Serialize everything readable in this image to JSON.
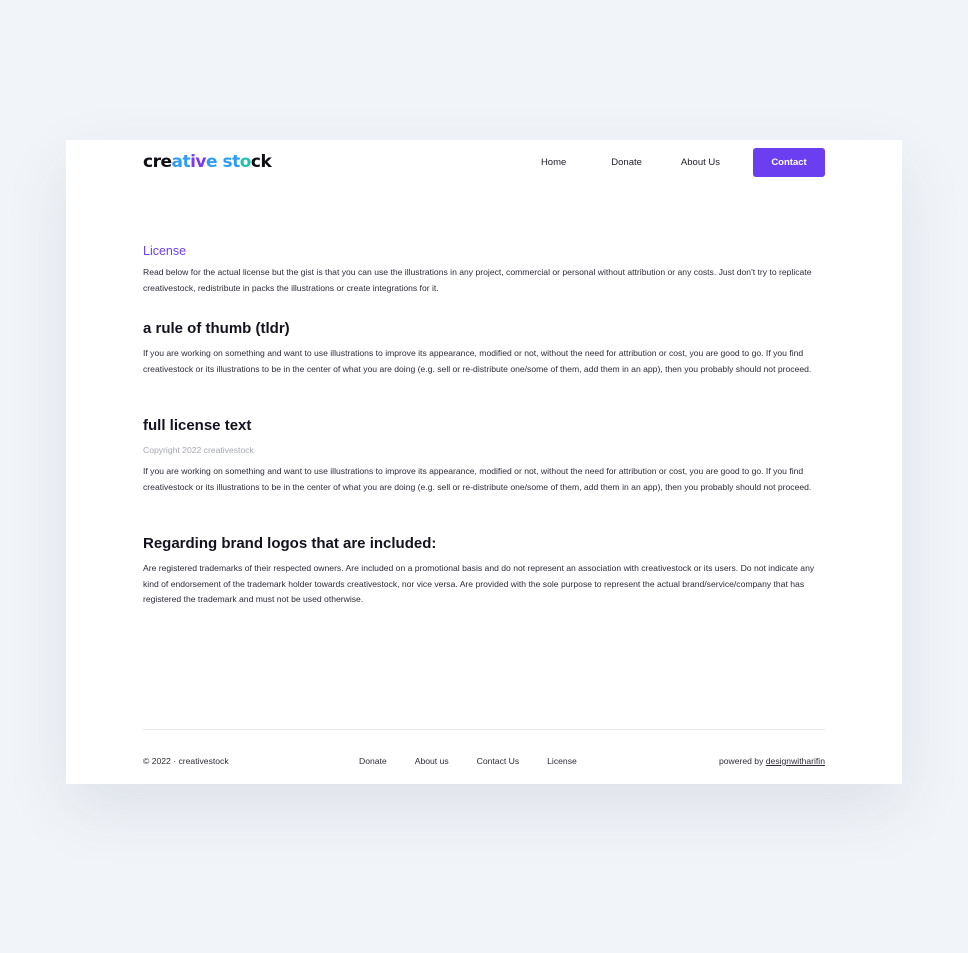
{
  "brand": {
    "logo_parts": [
      "cre",
      "at",
      "iv",
      "e st",
      "o",
      "ck"
    ],
    "logo_text": "creative stock"
  },
  "nav": {
    "home": "Home",
    "donate": "Donate",
    "about": "About Us",
    "contact": "Contact"
  },
  "content": {
    "kicker": "License",
    "intro": "Read below for the actual license but the gist is that you can use the illustrations in any project, commercial or personal without attribution or any costs. Just don't try to replicate creativestock, redistribute in packs the illustrations or create integrations for it.",
    "tldr_heading": "a rule of thumb (tldr)",
    "tldr_text": "If you are working on something and want to use illustrations to improve its appearance, modified or not, without the need for attribution or cost, you are good to go. If you find creativestock or its illustrations to be in the center of what you are doing (e.g. sell or re-distribute one/some of them, add them in an app), then you probably should not proceed.",
    "full_heading": "full license text",
    "copyright": "Copyright 2022 creativestock",
    "full_text": "If you are working on something and want to use illustrations to improve its appearance, modified or not, without the need for attribution or cost, you are good to go. If you find creativestock or its illustrations to be in the center of what you are doing (e.g. sell or re-distribute one/some of them, add them in an app), then you probably should not proceed.",
    "brand_heading": "Regarding brand logos that are included:",
    "brand_text": "Are registered trademarks of their respected owners. Are included on a promotional basis and do not represent an association with creativestock or its users. Do not indicate any kind of endorsement of the trademark holder towards creativestock, nor vice versa. Are provided with the sole purpose to represent the actual brand/service/company that has registered the trademark and must not be used otherwise."
  },
  "footer": {
    "copyright": "© 2022 · creativestock",
    "links": {
      "donate": "Donate",
      "about": "About us",
      "contact": "Contact Us",
      "license": "License"
    },
    "powered_prefix": "powered by ",
    "powered_link": "designwitharifin"
  },
  "colors": {
    "accent": "#6b3ff0",
    "background": "#f1f4f8",
    "card": "#ffffff"
  }
}
